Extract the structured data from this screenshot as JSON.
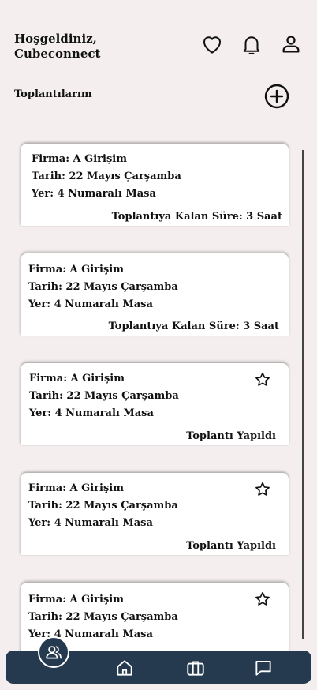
{
  "header": {
    "greeting_line1": "Hoşgeldiniz,",
    "greeting_line2": "Cubeconnect",
    "icons": [
      "heart-icon",
      "bell-icon",
      "user-icon"
    ]
  },
  "section": {
    "title": "Toplantılarım",
    "add_icon": "plus-circle-icon"
  },
  "meetings": [
    {
      "firma": "Firma: A Girişim",
      "tarih": "Tarih: 22 Mayıs Çarşamba",
      "yer": "Yer: 4 Numaralı Masa",
      "status": "Toplantıya Kalan Süre: 3 Saat",
      "starred_icon": false
    },
    {
      "firma": "Firma: A Girişim",
      "tarih": "Tarih: 22 Mayıs Çarşamba",
      "yer": "Yer: 4 Numaralı Masa",
      "status": "Toplantıya Kalan Süre: 3 Saat",
      "starred_icon": false
    },
    {
      "firma": "Firma: A Girişim",
      "tarih": "Tarih: 22 Mayıs Çarşamba",
      "yer": "Yer: 4 Numaralı Masa",
      "status": "Toplantı Yapıldı",
      "starred_icon": true
    },
    {
      "firma": "Firma: A Girişim",
      "tarih": "Tarih: 22 Mayıs Çarşamba",
      "yer": "Yer: 4 Numaralı Masa",
      "status": "Toplantı Yapıldı",
      "starred_icon": true
    },
    {
      "firma": "Firma: A Girişim",
      "tarih": "Tarih: 22 Mayıs Çarşamba",
      "yer": "Yer: 4 Numaralı Masa",
      "status": "",
      "starred_icon": true
    }
  ],
  "navbar": {
    "items": [
      "users-icon",
      "home-icon",
      "briefcase-icon",
      "chat-icon"
    ],
    "active": "users-icon"
  },
  "colors": {
    "background": "#f4eeee",
    "navbar": "#263a4f",
    "card": "#ffffff"
  }
}
